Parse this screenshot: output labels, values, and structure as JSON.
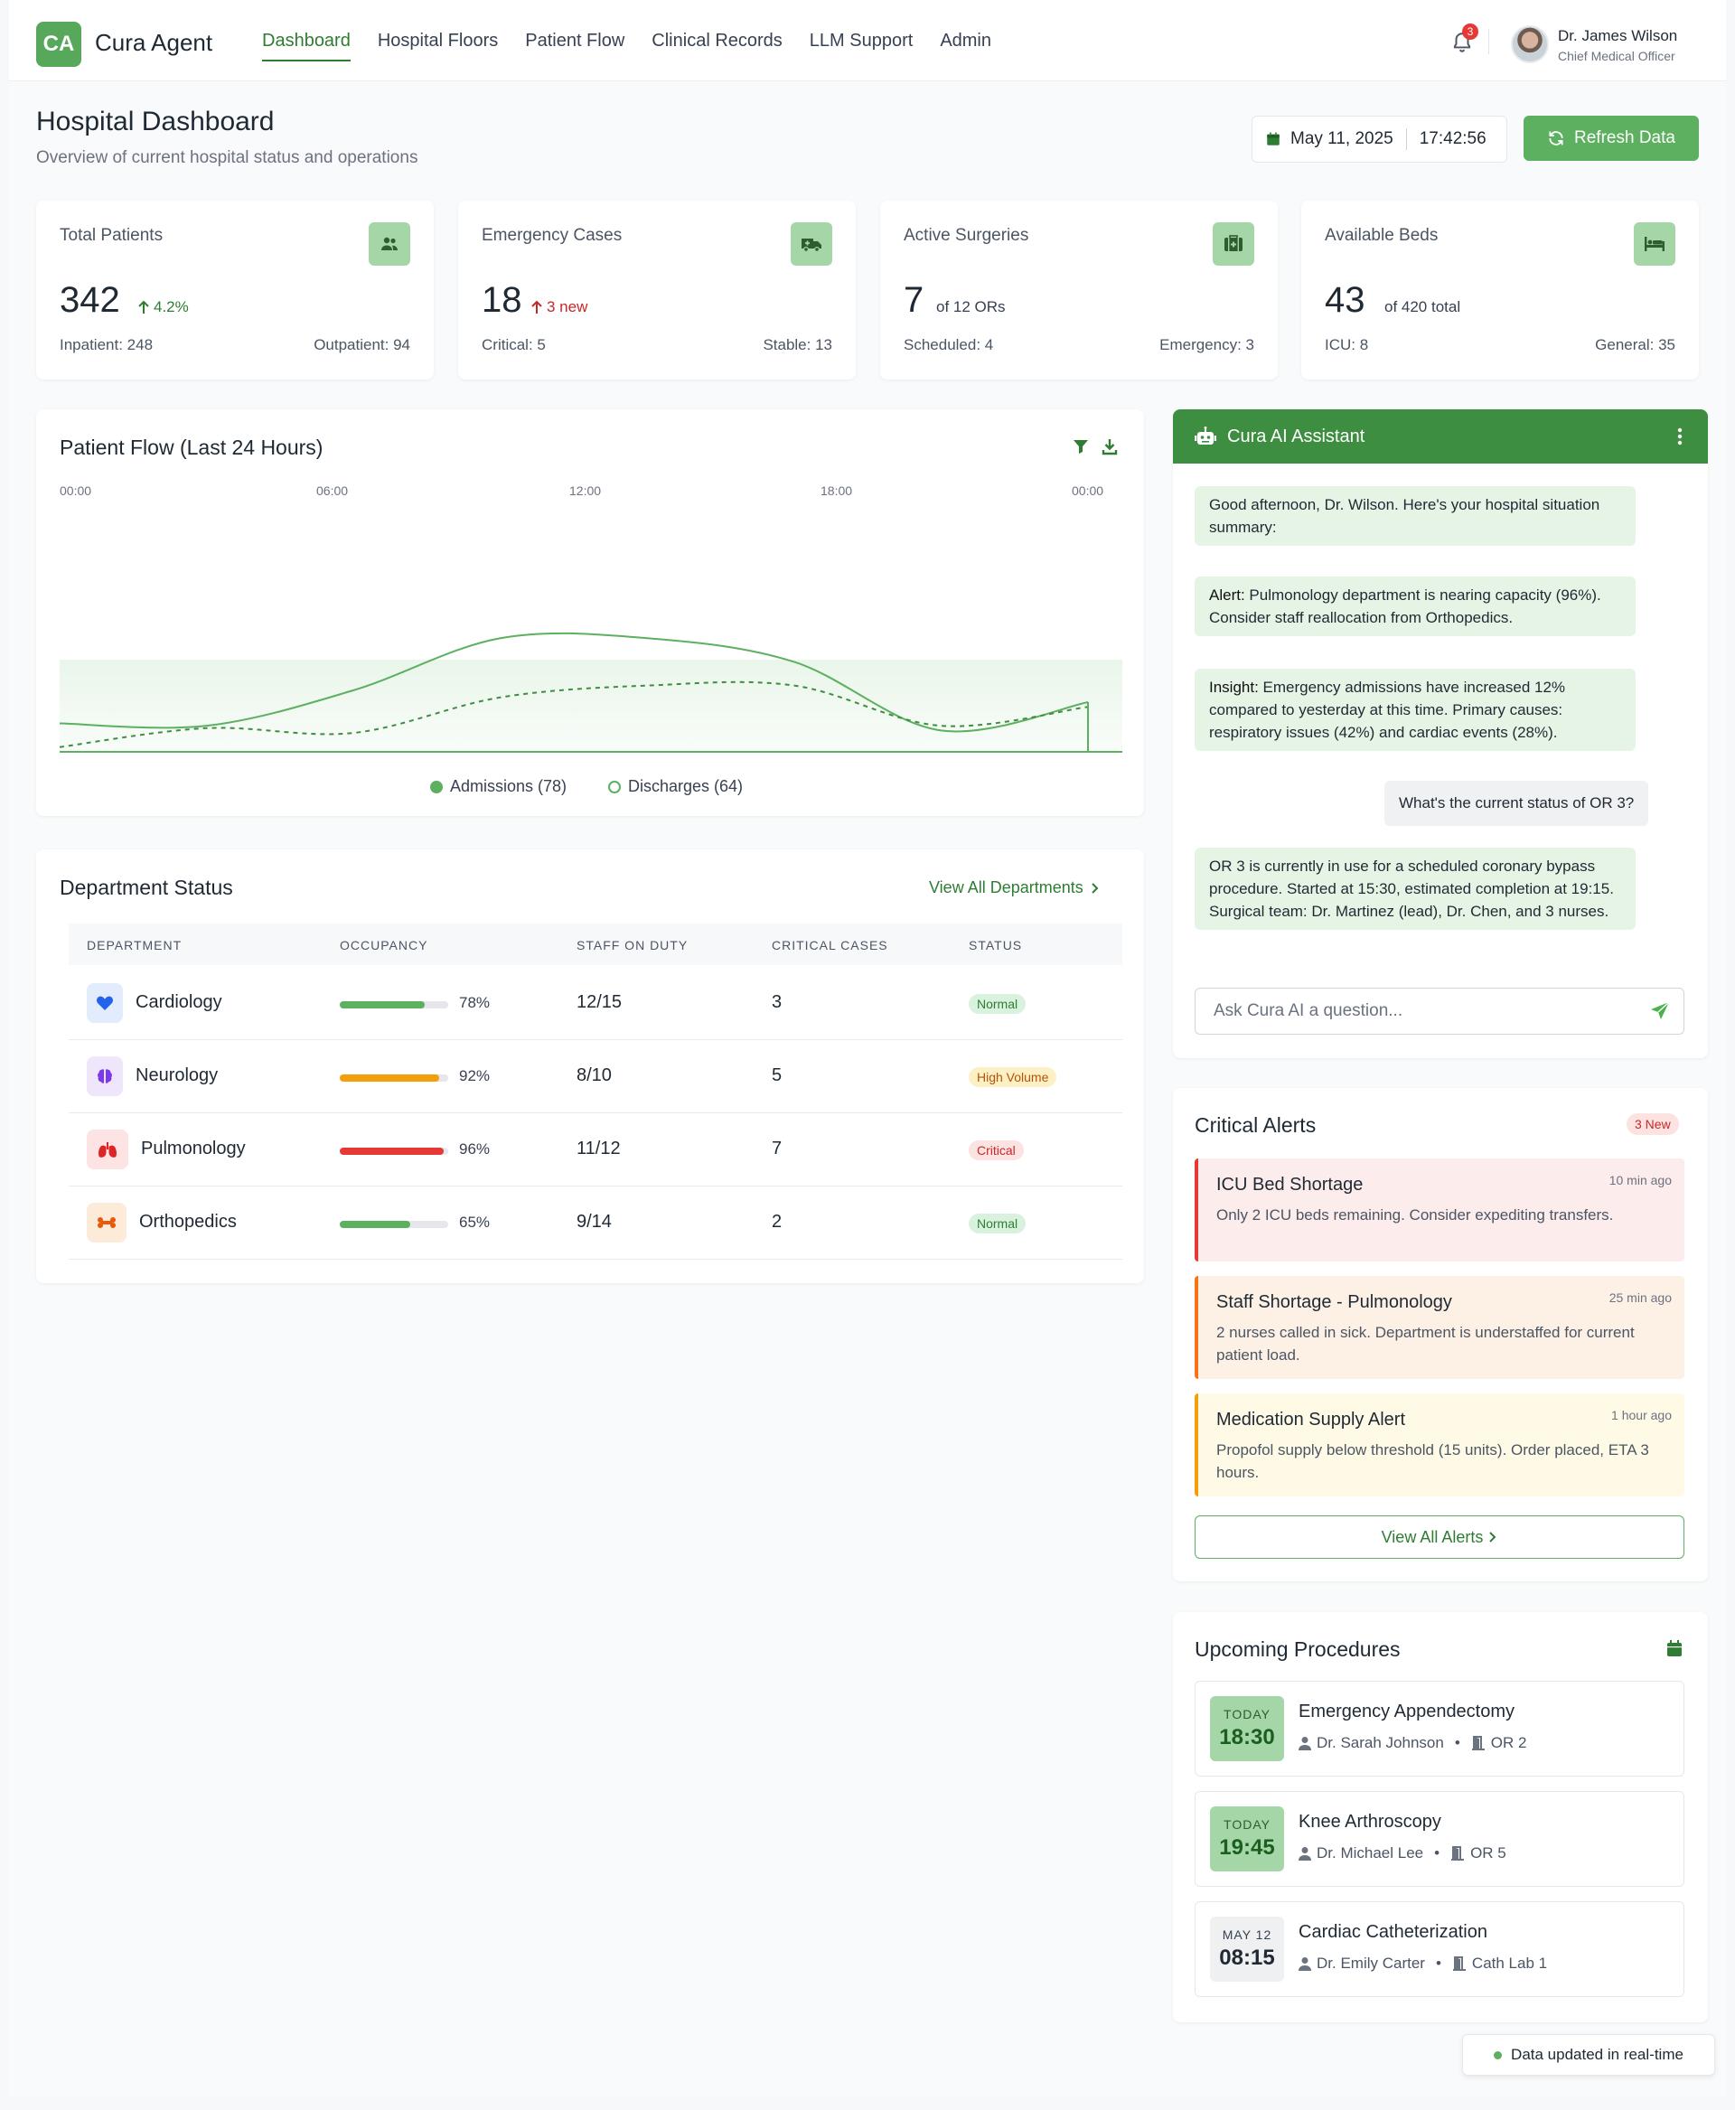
{
  "app": {
    "logo": "CA",
    "name": "Cura Agent"
  },
  "nav": [
    "Dashboard",
    "Hospital Floors",
    "Patient Flow",
    "Clinical Records",
    "LLM Support",
    "Admin"
  ],
  "notifications": {
    "count": "3"
  },
  "user": {
    "name": "Dr. James Wilson",
    "role": "Chief Medical Officer"
  },
  "page": {
    "title": "Hospital Dashboard",
    "subtitle": "Overview of current hospital status and operations",
    "date": "May 11, 2025",
    "time": "17:42:56",
    "refresh_label": "Refresh Data"
  },
  "stats": [
    {
      "title": "Total Patients",
      "value": "342",
      "sub": "4.2%",
      "foot_left": "Inpatient: 248",
      "foot_right": "Outpatient: 94",
      "icon": "users-icon"
    },
    {
      "title": "Emergency Cases",
      "value": "18",
      "sub": "3 new",
      "foot_left": "Critical: 5",
      "foot_right": "Stable: 13",
      "icon": "ambulance-icon"
    },
    {
      "title": "Active Surgeries",
      "value": "7",
      "sub": "of 12 ORs",
      "foot_left": "Scheduled: 4",
      "foot_right": "Emergency: 3",
      "icon": "first-aid-icon"
    },
    {
      "title": "Available Beds",
      "value": "43",
      "sub": "of 420 total",
      "foot_left": "ICU: 8",
      "foot_right": "General: 35",
      "icon": "bed-icon"
    }
  ],
  "colors": {
    "accent": "#5cb05f",
    "accent_dark": "#2e7d32",
    "danger": "#e53935",
    "warning": "#f59e0b"
  },
  "patient_flow": {
    "title": "Patient Flow (Last 24 Hours)",
    "legend": [
      "Admissions (78)",
      "Discharges (64)"
    ]
  },
  "chart_data": {
    "type": "line",
    "x": [
      "00:00",
      "06:00",
      "12:00",
      "18:00",
      "00:00"
    ],
    "series": [
      {
        "name": "Admissions (78)",
        "values": [
          0.12,
          0.11,
          0.26,
          0.48,
          0.48,
          0.38,
          0.09,
          0.21
        ],
        "style": "solid"
      },
      {
        "name": "Discharges (64)",
        "values": [
          0.02,
          0.1,
          0.08,
          0.23,
          0.28,
          0.28,
          0.11,
          0.19
        ],
        "style": "dashed"
      }
    ],
    "title": "Patient Flow (Last 24 Hours)",
    "grid": false
  },
  "departments": {
    "title": "Department Status",
    "view_all": "View All Departments",
    "headers": [
      "DEPARTMENT",
      "OCCUPANCY",
      "STAFF ON DUTY",
      "CRITICAL CASES",
      "STATUS"
    ],
    "rows": [
      {
        "name": "Cardiology",
        "occupancy": 0.78,
        "occupancy_label": "78%",
        "staff": "12/15",
        "critical": "3",
        "status": "Normal",
        "icon": "heart-icon"
      },
      {
        "name": "Neurology",
        "occupancy": 0.92,
        "occupancy_label": "92%",
        "staff": "8/10",
        "critical": "5",
        "status": "High Volume",
        "icon": "brain-icon"
      },
      {
        "name": "Pulmonology",
        "occupancy": 0.96,
        "occupancy_label": "96%",
        "staff": "11/12",
        "critical": "7",
        "status": "Critical",
        "icon": "lungs-icon"
      },
      {
        "name": "Orthopedics",
        "occupancy": 0.65,
        "occupancy_label": "65%",
        "staff": "9/14",
        "critical": "2",
        "status": "Normal",
        "icon": "bone-icon"
      }
    ]
  },
  "assistant": {
    "title": "Cura AI Assistant",
    "messages": [
      {
        "text": "Good afternoon, Dr. Wilson. Here's your hospital situation summary:"
      },
      {
        "prefix": "Alert:",
        "text": " Pulmonology department is nearing capacity (96%). Consider staff reallocation from Orthopedics."
      },
      {
        "prefix": "Insight:",
        "text": " Emergency admissions have increased 12% compared to yesterday at this time. Primary causes: respiratory issues (42%) and cardiac events (28%)."
      },
      {
        "text": "What's the current status of OR 3?"
      },
      {
        "text": "OR 3 is currently in use for a scheduled coronary bypass procedure. Started at 15:30, estimated completion at 19:15. Surgical team: Dr. Martinez (lead), Dr. Chen, and 3 nurses."
      }
    ],
    "input_placeholder": "Ask Cura AI a question..."
  },
  "alerts": {
    "title": "Critical Alerts",
    "badge": "3 New",
    "items": [
      {
        "title": "ICU Bed Shortage",
        "time": "10 min ago",
        "desc": "Only 2 ICU beds remaining. Consider expediting transfers."
      },
      {
        "title": "Staff Shortage - Pulmonology",
        "time": "25 min ago",
        "desc": "2 nurses called in sick. Department is understaffed for current patient load."
      },
      {
        "title": "Medication Supply Alert",
        "time": "1 hour ago",
        "desc": "Propofol supply below threshold (15 units). Order placed, ETA 3 hours."
      }
    ],
    "view_all": "View All Alerts"
  },
  "procedures": {
    "title": "Upcoming Procedures",
    "items": [
      {
        "day": "TODAY",
        "time": "18:30",
        "name": "Emergency Appendectomy",
        "doctor": "Dr. Sarah Johnson",
        "room": "OR 2"
      },
      {
        "day": "TODAY",
        "time": "19:45",
        "name": "Knee Arthroscopy",
        "doctor": "Dr. Michael Lee",
        "room": "OR 5"
      },
      {
        "day": "MAY 12",
        "time": "08:15",
        "name": "Cardiac Catheterization",
        "doctor": "Dr. Emily Carter",
        "room": "Cath Lab 1"
      }
    ]
  },
  "footer": {
    "realtime": "Data updated in real-time"
  }
}
